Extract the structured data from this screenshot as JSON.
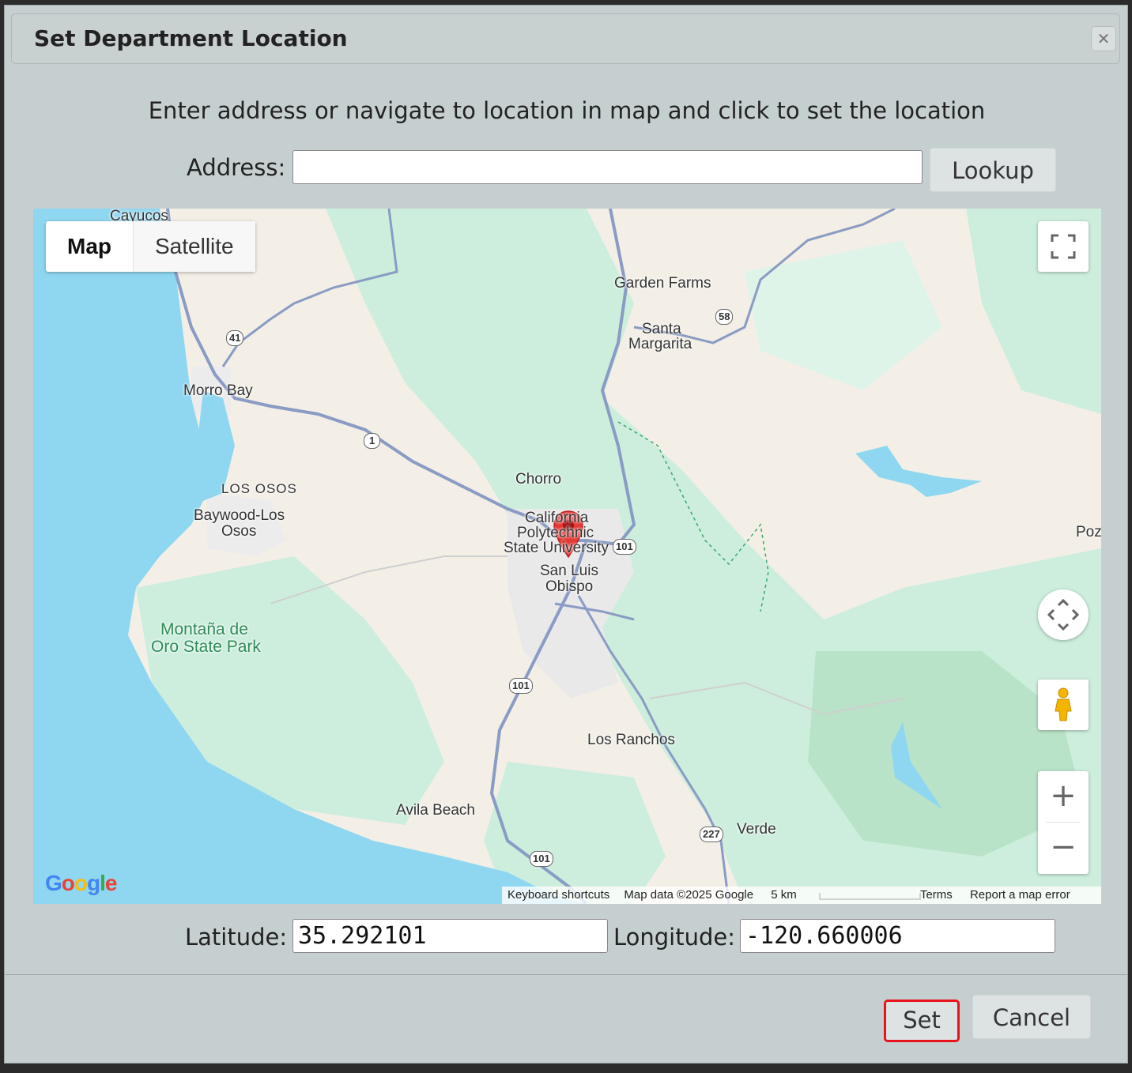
{
  "dialog": {
    "title": "Set Department Location",
    "close_icon": "close-icon",
    "instructions": "Enter address or navigate to location in map and click to set the location",
    "address_label": "Address:",
    "address_value": "",
    "lookup_label": "Lookup",
    "latitude_label": "Latitude:",
    "latitude_value": "35.292101",
    "longitude_label": "Longitude:",
    "longitude_value": "-120.660006",
    "set_label": "Set",
    "cancel_label": "Cancel",
    "highlight_color": "#e8141c"
  },
  "map": {
    "type_buttons": [
      "Map",
      "Satellite"
    ],
    "active_type": "Map",
    "places": {
      "cayucos": "Cayucos",
      "garden_farms": "Garden Farms",
      "santa_margarita_1": "Santa",
      "santa_margarita_2": "Margarita",
      "morro_bay": "Morro Bay",
      "chorro": "Chorro",
      "los_osos": "LOS OSOS",
      "baywood_1": "Baywood-Los",
      "baywood_2": "Osos",
      "cal_poly_1": "California",
      "cal_poly_2": "Polytechnic",
      "cal_poly_3": "State University",
      "slo_1": "San Luis",
      "slo_2": "Obispo",
      "montana_1": "Montaña de",
      "montana_2": "Oro State Park",
      "los_ranchos": "Los Ranchos",
      "avila_beach": "Avila Beach",
      "verde": "Verde",
      "poz": "Poz"
    },
    "shields": {
      "r41": "41",
      "r58": "58",
      "r1": "1",
      "r101a": "101",
      "r101b": "101",
      "r101c": "101",
      "r227": "227"
    },
    "logo": "Google",
    "footer": {
      "shortcuts": "Keyboard shortcuts",
      "map_data": "Map data ©2025 Google",
      "scale": "5 km",
      "terms": "Terms",
      "report": "Report a map error"
    },
    "colors": {
      "water": "#8fd7f0",
      "land": "#f3efe6",
      "park": "#cdeedd",
      "road": "#8a9bc4",
      "marker": "#e53935"
    }
  }
}
